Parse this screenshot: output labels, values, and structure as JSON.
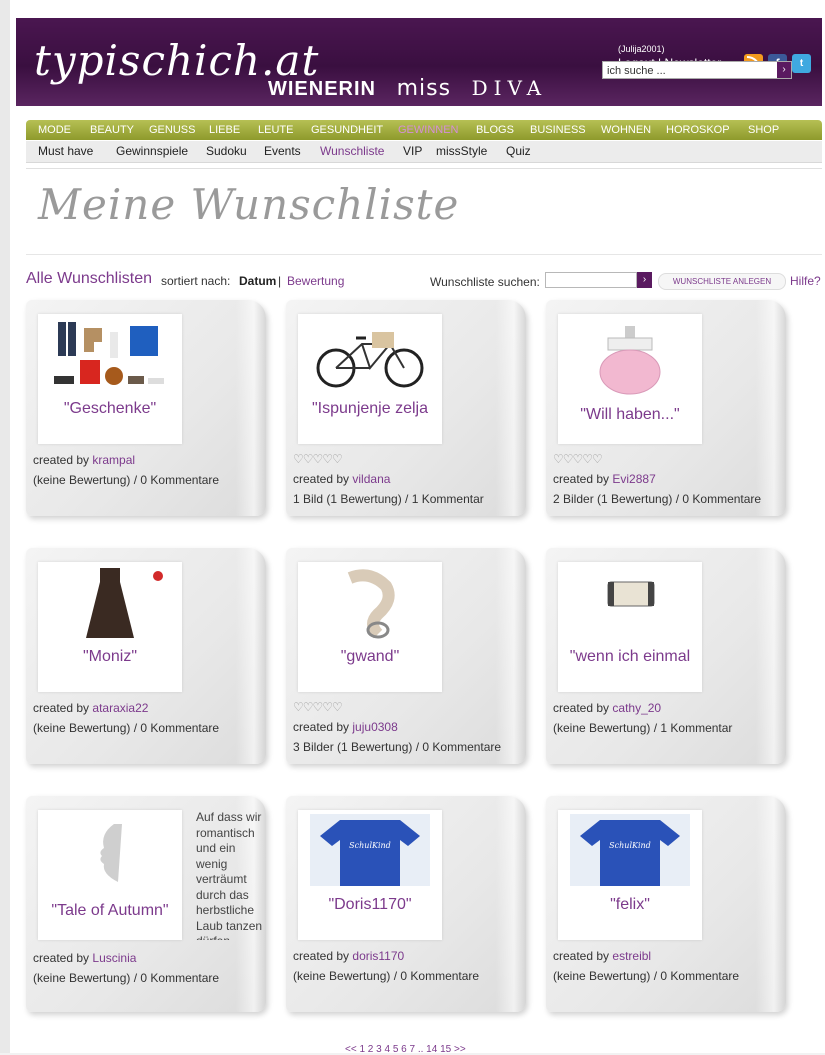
{
  "header": {
    "logo": "typischich.at",
    "brands": [
      "WIENERIN",
      "miss",
      "DIVA"
    ],
    "username": "(Julija2001)",
    "logout_label": "Logout",
    "newsletter_label": "Newsletter",
    "link_separator": "|",
    "search_placeholder": "ich suche ..."
  },
  "nav": {
    "main": [
      "MODE",
      "BEAUTY",
      "GENUSS",
      "LIEBE",
      "LEUTE",
      "GESUNDHEIT",
      "GEWINNEN",
      "BLOGS",
      "BUSINESS",
      "WOHNEN",
      "HOROSKOP",
      "SHOP"
    ],
    "active_main": "GEWINNEN",
    "sub": [
      "Must have",
      "Gewinnspiele",
      "Sudoku",
      "Events",
      "Wunschliste",
      "VIP",
      "missStyle",
      "Quiz"
    ],
    "active_sub": "Wunschliste",
    "active_color": "#d48fd8",
    "nav_color": "#9aa436"
  },
  "page": {
    "title": "Meine Wunschliste"
  },
  "toolbar": {
    "all_lists": "Alle Wunschlisten",
    "sort_label": "sortiert nach:",
    "sort_date": "Datum",
    "sort_separator": "|",
    "sort_rating": "Bewertung",
    "search_label": "Wunschliste suchen:",
    "create_button": "WUNSCHLISTE ANLEGEN",
    "help_label": "Hilfe?"
  },
  "created_by_label": "created by",
  "wishlists": [
    {
      "name": "\"Geschenke\"",
      "user": "krampal",
      "stats": "(keine Bewertung) / 0 Kommentare",
      "rating": 0,
      "hearts": "",
      "desc": "",
      "image": "clothes-collage-icon"
    },
    {
      "name": "\"Ispunjenje zelja",
      "user": "vildana",
      "stats": "1 Bild (1 Bewertung) / 1 Kommentar",
      "rating": 5,
      "hearts": "♡♡♡♡♡",
      "desc": "",
      "image": "bicycle-icon"
    },
    {
      "name": "\"Will haben...\"",
      "user": "Evi2887",
      "stats": "2 Bilder (1 Bewertung) / 0 Kommentare",
      "rating": 5,
      "hearts": "♡♡♡♡♡",
      "desc": "",
      "image": "perfume-icon"
    },
    {
      "name": "\"Moniz\"",
      "user": "ataraxia22",
      "stats": "(keine Bewertung) / 0 Kommentare",
      "rating": 0,
      "hearts": "",
      "desc": "",
      "image": "dress-icon"
    },
    {
      "name": "\"gwand\"",
      "user": "juju0308",
      "stats": "3 Bilder (1 Bewertung) / 0 Kommentare",
      "rating": 5,
      "hearts": "♡♡♡♡♡",
      "desc": "",
      "image": "belt-icon"
    },
    {
      "name": "\"wenn ich einmal",
      "user": "cathy_20",
      "stats": "(keine Bewertung) / 1 Kommentar",
      "rating": 0,
      "hearts": "",
      "desc": "",
      "image": "clutch-icon"
    },
    {
      "name": "\"Tale of Autumn\"",
      "user": "Luscinia",
      "stats": "(keine Bewertung) / 0 Kommentare",
      "rating": 0,
      "hearts": "",
      "desc": "Auf dass wir romantisch und ein wenig verträumt durch das herbstliche Laub tanzen dürfen",
      "image": "face-sculpture-icon"
    },
    {
      "name": "\"Doris1170\"",
      "user": "doris1170",
      "stats": "(keine Bewertung) / 0 Kommentare",
      "rating": 0,
      "hearts": "",
      "desc": "",
      "image": "tshirt-icon"
    },
    {
      "name": "\"felix\"",
      "user": "estreibl",
      "stats": "(keine Bewertung) / 0 Kommentare",
      "rating": 0,
      "hearts": "",
      "desc": "",
      "image": "tshirt-icon"
    }
  ],
  "tshirt_print": "SchulKind",
  "pagination": "<< 1 2 3 4 5 6 7 .. 14 15 >>"
}
